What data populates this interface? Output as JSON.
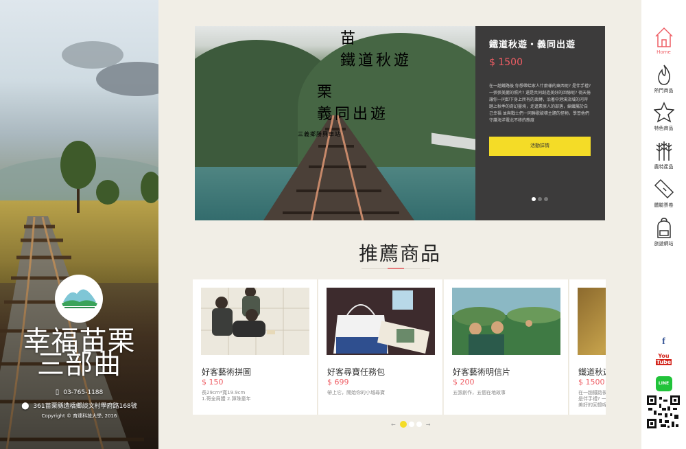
{
  "colors": {
    "accent": "#ee5d64",
    "yellow": "#f4dc27",
    "panel": "#3c3b3b",
    "bg": "#f1eee6"
  },
  "brand": {
    "title_line1": "幸福苗栗",
    "title_line2": "三部曲",
    "phone": "03-765-1188",
    "address": "361苗栗縣造橋鄉談文村學府路168號",
    "copyright": "Copyright © 育達科技大學, 2016"
  },
  "hero": {
    "overlay_line1": "苗",
    "overlay_line2": "鐵道秋遊",
    "overlay_line3": "栗",
    "overlay_line4": "義同出遊",
    "overlay_small": "三義鄉勝興車站",
    "title": "鐵道秋遊・義同出遊",
    "price": "$ 1500",
    "description": "在一趟鐵路後 你想帶給家人什麼樣的東西呢? 是伴手禮? 一張張美麗的照片? 還是共同創造美好的回憶呢? 徜天倦讓你一同卸下身上所有的束縛，沿著中港溪流域的河岸 踏上秋季的奇幻靈境，走進素原人的部落，編織屬於自己幸福 並與戰士們一同聯歌破壞主題的怪物，學習他們守護海洋電北不移的態度",
    "button_label": "活動詳情"
  },
  "section": {
    "title": "推薦商品"
  },
  "products": [
    {
      "name": "好客藝術拼圖",
      "price": "$ 150",
      "desc": "長29cm*寬19.9cm\n1.哥全局體  2.彈珠童年"
    },
    {
      "name": "好客尋寶任務包",
      "price": "$ 699",
      "desc": "帶上它，開始你的小城尋寶"
    },
    {
      "name": "好客藝術明信片",
      "price": "$ 200",
      "desc": "五張創作，五個在地故事"
    },
    {
      "name": "鐵道秋遊・義同出遊",
      "price": "$ 1500",
      "desc": "在一趟鐵路後 你想帶給家人什麼樣的東西呢?\n是伴手禮? 一張張美麗的照片?\n美好的回憶呢?"
    }
  ],
  "pager": {
    "prev": "←",
    "next": "→"
  },
  "nav": [
    {
      "label": "Home",
      "icon": "home-icon"
    },
    {
      "label": "熱門商品",
      "icon": "flame-icon"
    },
    {
      "label": "特色商品",
      "icon": "star-icon"
    },
    {
      "label": "農特產品",
      "icon": "wheat-icon"
    },
    {
      "label": "體驗票卷",
      "icon": "ticket-icon"
    },
    {
      "label": "旅遊網站",
      "icon": "backpack-icon"
    }
  ],
  "social": {
    "facebook": "f",
    "youtube_top": "You",
    "youtube_bottom": "Tube",
    "line": "LINE"
  }
}
